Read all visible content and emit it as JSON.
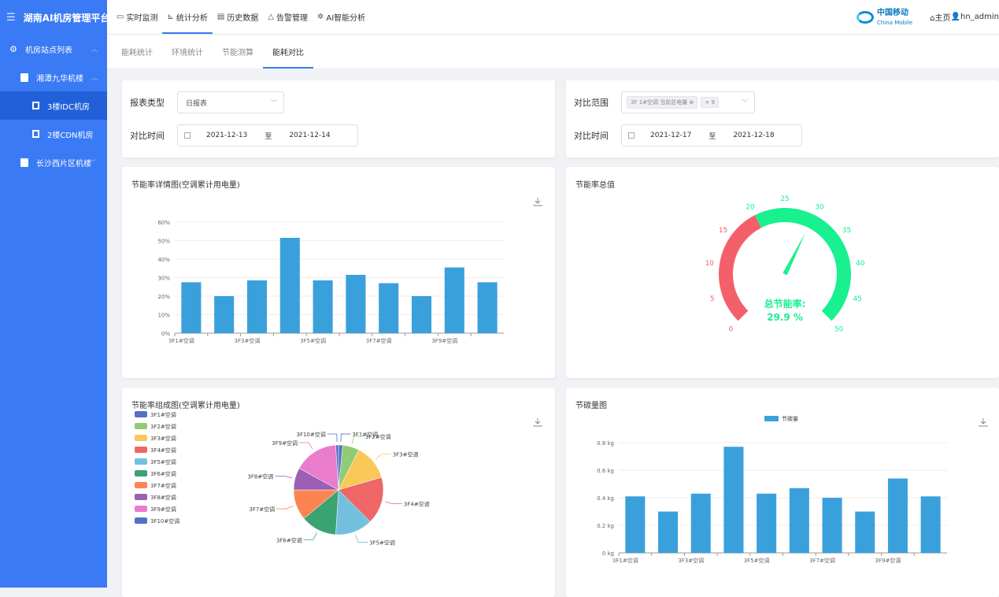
{
  "app": {
    "title": "湖南AI机房管理平台"
  },
  "sidebar": {
    "items": [
      {
        "label": "机房站点列表",
        "level": 1
      },
      {
        "label": "湘潭九华机楼",
        "level": 2
      },
      {
        "label": "3楼IDC机房",
        "level": 3,
        "active": true
      },
      {
        "label": "2楼CDN机房",
        "level": 3
      },
      {
        "label": "长沙西片区机楼",
        "level": 2
      }
    ]
  },
  "topmenu": [
    {
      "label": "实时监测",
      "icon": "monitor-icon"
    },
    {
      "label": "统计分析",
      "icon": "chart-icon",
      "active": true
    },
    {
      "label": "历史数据",
      "icon": "document-icon"
    },
    {
      "label": "告警管理",
      "icon": "warning-icon"
    },
    {
      "label": "AI智能分析",
      "icon": "gear-icon"
    }
  ],
  "header": {
    "logo_zh": "中国移动",
    "logo_en": "China Mobile",
    "home": "主页",
    "user": "hn_admin"
  },
  "subtabs": [
    "能耗统计",
    "环境统计",
    "节能测算",
    "能耗对比"
  ],
  "filters_left": {
    "report_type_label": "报表类型",
    "report_type_value": "日报表",
    "time_label": "对比时间",
    "start": "2021-12-13",
    "sep": "至",
    "end": "2021-12-14"
  },
  "filters_right": {
    "range_label": "对比范围",
    "range_tag": "3F 1#空调 当前总电量",
    "range_more": "+ 9",
    "time_label": "对比时间",
    "start": "2021-12-17",
    "sep": "至",
    "end": "2021-12-18"
  },
  "colors": {
    "accent": "#3a7af5",
    "bar": "#3aa0dc",
    "gauge_red": "#f4606a",
    "gauge_green": "#19f090",
    "pie": [
      "#5470c6",
      "#91cc75",
      "#fac858",
      "#ee6666",
      "#73c0de",
      "#3ba272",
      "#fc8452",
      "#9a60b4",
      "#ea7ccc",
      "#5470c6"
    ]
  },
  "cards": {
    "detail_title": "节能率详情图(空调累计用电量)",
    "total_title": "节能率总值",
    "pie_title": "节能率组成图(空调累计用电量)",
    "carbon_title": "节碳量图"
  },
  "chart_data": [
    {
      "type": "bar",
      "title": "节能率详情图(空调累计用电量)",
      "categories": [
        "3F1#空调",
        "3F2#空调",
        "3F3#空调",
        "3F4#空调",
        "3F5#空调",
        "3F6#空调",
        "3F7#空调",
        "3F8#空调",
        "3F9#空调",
        "3F10#空调"
      ],
      "tick_labels": [
        "3F1#空调",
        "3F3#空调",
        "3F5#空调",
        "3F7#空调",
        "3F9#空调"
      ],
      "values": [
        27.5,
        20,
        28.5,
        51.5,
        28.5,
        31.5,
        27,
        20,
        35.5,
        27.5
      ],
      "yticks": [
        "0%",
        "10%",
        "20%",
        "30%",
        "40%",
        "50%",
        "60%"
      ],
      "ylim": [
        0,
        60
      ],
      "grid": true
    },
    {
      "type": "gauge",
      "title": "节能率总值",
      "value": 29.9,
      "min": 0,
      "max": 50,
      "ticks": [
        "0",
        "5",
        "10",
        "15",
        "20",
        "25",
        "30",
        "35",
        "40",
        "45",
        "50"
      ],
      "label": "总节能率:",
      "value_text": "29.9 %"
    },
    {
      "type": "pie",
      "title": "节能率组成图(空调累计用电量)",
      "categories": [
        "3F1#空调",
        "3F2#空调",
        "3F3#空调",
        "3F4#空调",
        "3F5#空调",
        "3F6#空调",
        "3F7#空调",
        "3F8#空调",
        "3F9#空调",
        "3F10#空调"
      ],
      "values": [
        1.5,
        6,
        13,
        17,
        13.5,
        13,
        11,
        8,
        16,
        1
      ],
      "legend": "left"
    },
    {
      "type": "bar",
      "title": "节碳量图",
      "legend": [
        "节碳量"
      ],
      "categories": [
        "3F1#空调",
        "3F2#空调",
        "3F3#空调",
        "3F4#空调",
        "3F5#空调",
        "3F6#空调",
        "3F7#空调",
        "3F8#空调",
        "3F9#空调",
        "3F10#空调"
      ],
      "tick_labels": [
        "3F1#空调",
        "3F3#空调",
        "3F5#空调",
        "3F7#空调",
        "3F9#空调"
      ],
      "values": [
        0.41,
        0.3,
        0.43,
        0.77,
        0.43,
        0.47,
        0.4,
        0.3,
        0.54,
        0.41
      ],
      "yticks": [
        "0 kg",
        "0.2 kg",
        "0.4 kg",
        "0.6 kg",
        "0.8 kg"
      ],
      "ylim": [
        0,
        0.8
      ],
      "grid": true
    }
  ]
}
